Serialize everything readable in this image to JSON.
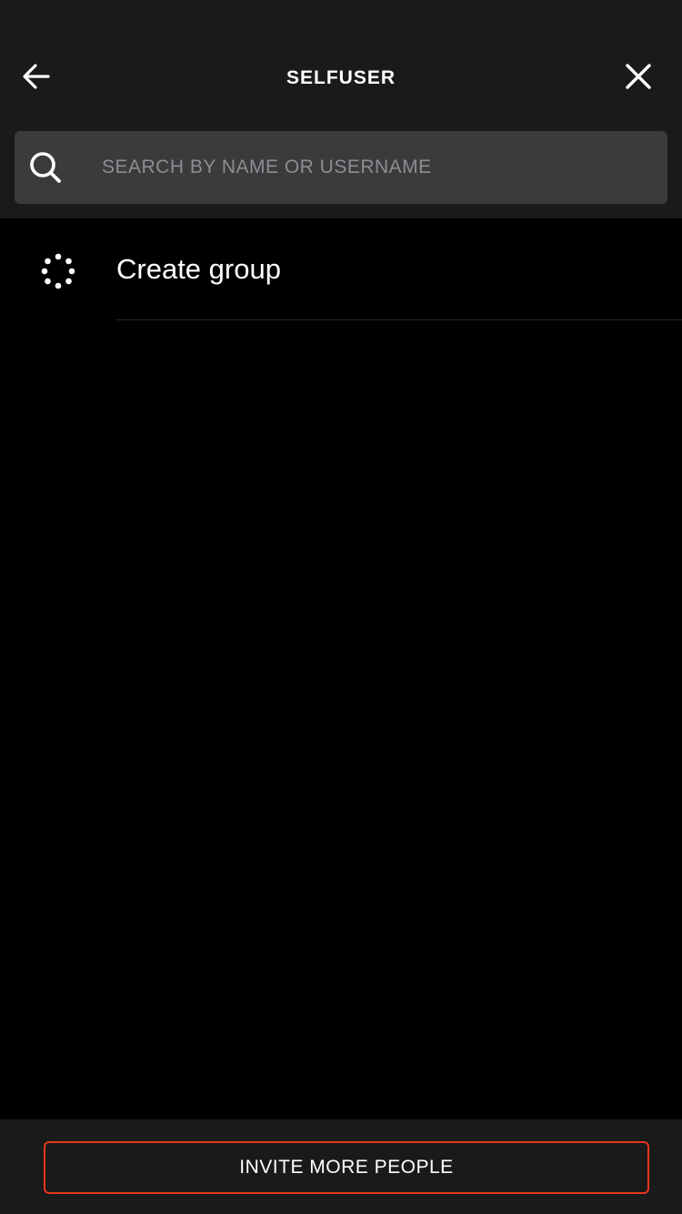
{
  "header": {
    "title": "SELFUSER",
    "back_icon": "arrow-left-icon",
    "close_icon": "close-icon"
  },
  "search": {
    "placeholder": "SEARCH BY NAME OR USERNAME",
    "value": "",
    "icon": "search-icon"
  },
  "list": {
    "items": [
      {
        "label": "Create group",
        "icon": "group-icon"
      }
    ]
  },
  "footer": {
    "invite_label": "INVITE MORE PEOPLE"
  },
  "colors": {
    "background": "#000000",
    "header_bg": "#1a1a1b",
    "search_bg": "#3b3b3d",
    "accent": "#e7371b",
    "placeholder": "#8e8e92"
  }
}
